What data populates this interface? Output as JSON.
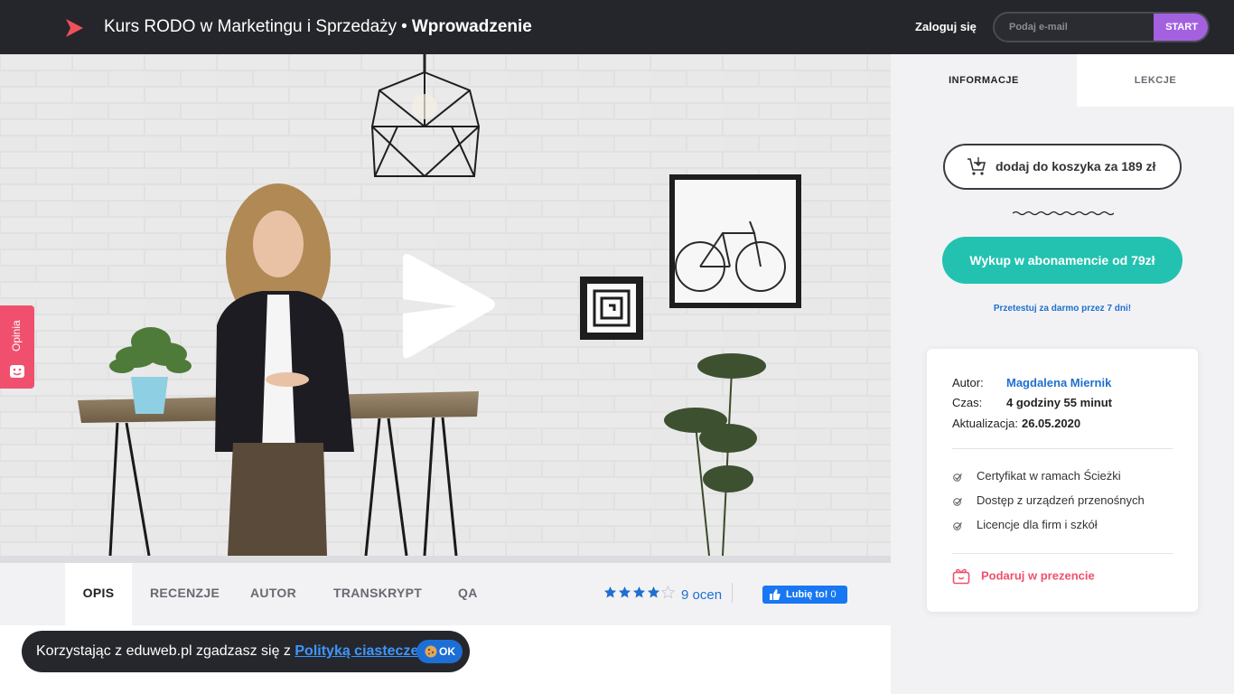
{
  "header": {
    "course_title": "Kurs RODO w Marketingu i Sprzedaży",
    "separator": "•",
    "lesson_title": "Wprowadzenie",
    "login_label": "Zaloguj się",
    "email_placeholder": "Podaj e-mail",
    "start_label": "START",
    "logo_icon": "play-logo-icon",
    "brand_color": "#f0505a"
  },
  "video": {
    "play_icon": "play-icon"
  },
  "feedback": {
    "label": "Opinia",
    "icon": "smile-icon"
  },
  "tabs": [
    {
      "label": "OPIS",
      "active": true
    },
    {
      "label": "RECENZJE",
      "active": false
    },
    {
      "label": "AUTOR",
      "active": false
    },
    {
      "label": "TRANSKRYPT",
      "active": false
    },
    {
      "label": "QA",
      "active": false
    }
  ],
  "rating": {
    "stars": 4,
    "max": 5,
    "count_label": "9 ocen"
  },
  "facebook": {
    "label": "Lubię to!",
    "count": "0"
  },
  "cookie": {
    "text": "Korzystając z eduweb.pl zgadzasz się z",
    "link": "Polityką ciasteczek",
    "ok_label": "OK"
  },
  "sidebar": {
    "tab_info": "INFORMACJE",
    "tab_lessons": "LEKCJE",
    "cart_label": "dodaj do koszyka za 189 zł",
    "subscribe_label": "Wykup w abonamencie od 79zł",
    "trial_label": "Przetestuj za darmo przez 7 dni!",
    "author_key": "Autor:",
    "author_value": "Magdalena Miernik",
    "time_key": "Czas:",
    "time_value": "4 godziny 55 minut",
    "update_key": "Aktualizacja:",
    "update_value": "26.05.2020",
    "features": [
      "Certyfikat w ramach Ścieżki",
      "Dostęp z urządzeń przenośnych",
      "Licencje dla firm i szkół"
    ],
    "gift_label": "Podaruj w prezencie",
    "accent_teal": "#23c2b0",
    "accent_pink": "#f0506e",
    "link_blue": "#1f6fd0"
  }
}
